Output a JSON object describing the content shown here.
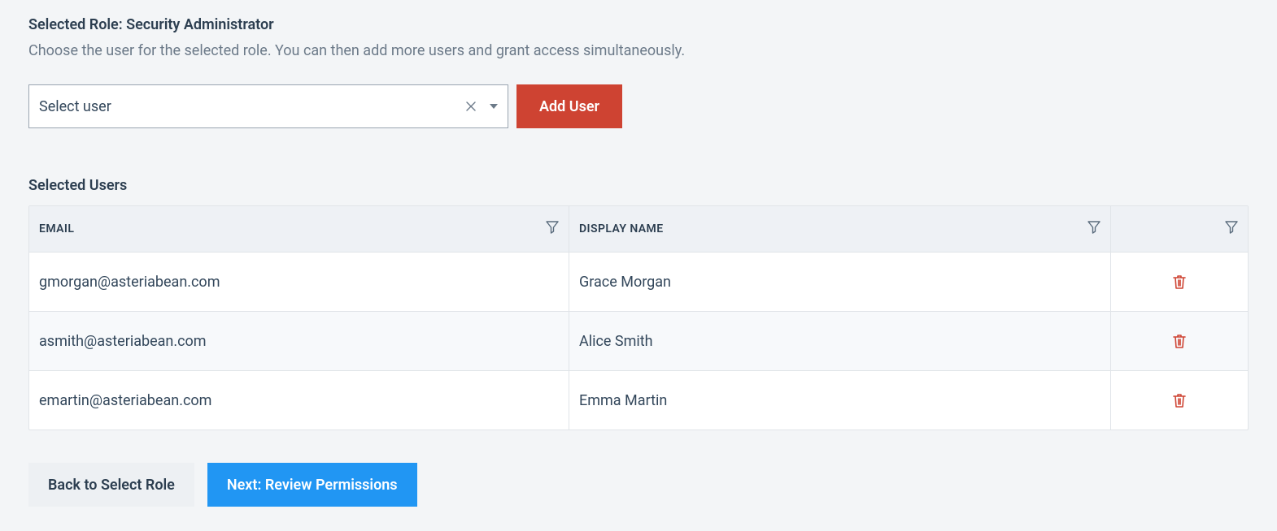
{
  "role": {
    "title_label": "Selected Role: Security Administrator",
    "description": "Choose the user for the selected role. You can then add more users and grant access simultaneously."
  },
  "actions": {
    "select_user_placeholder": "Select user",
    "add_user_label": "Add User",
    "back_label": "Back to Select Role",
    "next_label": "Next: Review Permissions"
  },
  "table": {
    "title": "Selected Users",
    "headers": {
      "email": "EMAIL",
      "display_name": "DISPLAY NAME"
    },
    "rows": [
      {
        "email": "gmorgan@asteriabean.com",
        "name": "Grace Morgan"
      },
      {
        "email": "asmith@asteriabean.com",
        "name": "Alice Smith"
      },
      {
        "email": "emartin@asteriabean.com",
        "name": "Emma Martin"
      }
    ]
  },
  "colors": {
    "danger": "#CE4332",
    "primary": "#2196F3"
  }
}
